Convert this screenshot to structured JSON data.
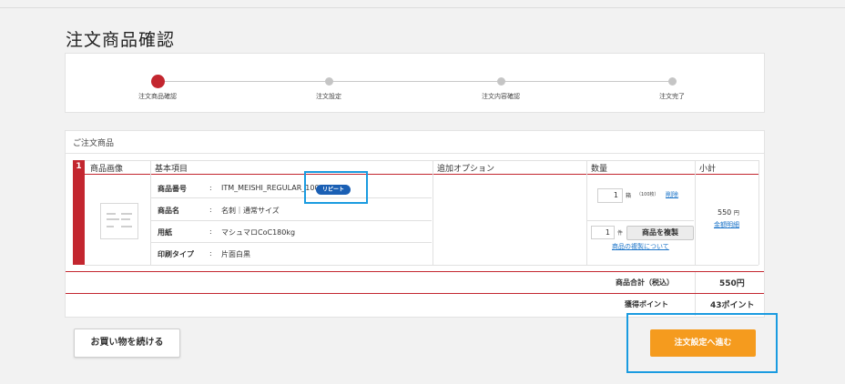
{
  "page": {
    "title": "注文商品確認"
  },
  "steps": [
    {
      "label": "注文商品確認",
      "active": true
    },
    {
      "label": "注文設定",
      "active": false
    },
    {
      "label": "注文内容確認",
      "active": false
    },
    {
      "label": "注文完了",
      "active": false
    }
  ],
  "order": {
    "section_title": "ご注文商品",
    "row_number": "1",
    "columns": {
      "image": "商品画像",
      "basic": "基本項目",
      "options": "追加オプション",
      "quantity": "数量",
      "subtotal": "小計"
    },
    "details": [
      {
        "label": "商品番号",
        "value": "ITM_MEISHI_REGULAR_100"
      },
      {
        "label": "商品名",
        "value": "名刺｜通常サイズ"
      },
      {
        "label": "用紙",
        "value": "マシュマロCoC180kg"
      },
      {
        "label": "印刷タイプ",
        "value": "片面白黒"
      }
    ],
    "separator": ":",
    "repeat_badge": "リピート",
    "quantity": {
      "value": "1",
      "unit": "箱",
      "note": "（100枚）",
      "delete_link": "削除"
    },
    "duplicate": {
      "count": "1",
      "unit": "件",
      "button": "商品を複製",
      "about_link": "商品の複製について"
    },
    "subtotal": {
      "amount": "550",
      "unit": "円",
      "detail_link": "金額明細"
    }
  },
  "summary": {
    "total_label": "商品合計（税込）",
    "total_value": "550円",
    "points_label": "獲得ポイント",
    "points_value": "43ポイント"
  },
  "actions": {
    "continue_shopping": "お買い物を続ける",
    "proceed": "注文設定へ進む"
  },
  "colors": {
    "accent_red": "#c3262f",
    "primary_orange": "#f59b1e",
    "link_blue": "#1a73c8",
    "highlight_blue": "#1a9be0"
  }
}
